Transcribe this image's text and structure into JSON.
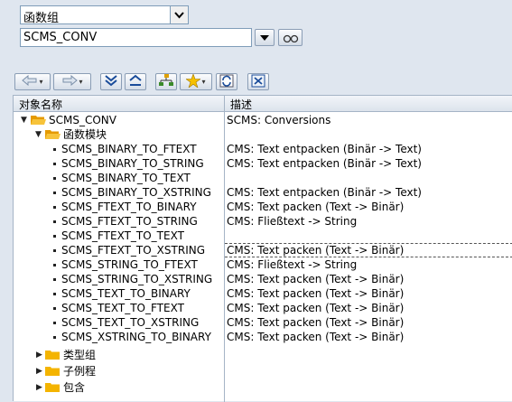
{
  "header": {
    "function_group_select": "函数组",
    "search_value": "SCMS_CONV"
  },
  "toolbar": {
    "buttons": [
      "back-arrow-icon",
      "forward-arrow-icon",
      "expand-all-icon",
      "collapse-all-icon",
      "hierarchy-icon",
      "favorite-star-icon",
      "refresh-icon",
      "close-icon"
    ]
  },
  "tree": {
    "columns": [
      "对象名称",
      "描述"
    ],
    "root": {
      "label": "SCMS_CONV",
      "desc": "SCMS: Conversions"
    },
    "module_folder": "函数模块",
    "functions": [
      {
        "name": "SCMS_BINARY_TO_FTEXT",
        "desc": "CMS: Text entpacken (Binär -> Text)"
      },
      {
        "name": "SCMS_BINARY_TO_STRING",
        "desc": "CMS: Text entpacken (Binär -> Text)"
      },
      {
        "name": "SCMS_BINARY_TO_TEXT",
        "desc": ""
      },
      {
        "name": "SCMS_BINARY_TO_XSTRING",
        "desc": "CMS: Text entpacken (Binär -> Text)"
      },
      {
        "name": "SCMS_FTEXT_TO_BINARY",
        "desc": "CMS: Text packen (Text -> Binär)"
      },
      {
        "name": "SCMS_FTEXT_TO_STRING",
        "desc": "CMS: Fließtext -> String"
      },
      {
        "name": "SCMS_FTEXT_TO_TEXT",
        "desc": ""
      },
      {
        "name": "SCMS_FTEXT_TO_XSTRING",
        "desc": "CMS: Text packen (Text -> Binär)"
      },
      {
        "name": "SCMS_STRING_TO_FTEXT",
        "desc": "CMS: Fließtext -> String"
      },
      {
        "name": "SCMS_STRING_TO_XSTRING",
        "desc": "CMS: Text packen (Text -> Binär)"
      },
      {
        "name": "SCMS_TEXT_TO_BINARY",
        "desc": "CMS: Text packen (Text -> Binär)"
      },
      {
        "name": "SCMS_TEXT_TO_FTEXT",
        "desc": "CMS: Text packen (Text -> Binär)"
      },
      {
        "name": "SCMS_TEXT_TO_XSTRING",
        "desc": "CMS: Text packen (Text -> Binär)"
      },
      {
        "name": "SCMS_XSTRING_TO_BINARY",
        "desc": "CMS: Text packen (Text -> Binär)"
      }
    ],
    "other_folders": [
      "类型组",
      "子例程",
      "包含"
    ],
    "selected_function": "SCMS_FTEXT_TO_XSTRING"
  },
  "colors": {
    "folder": "#f4b400",
    "selection_border": "#e03030",
    "header_bg": "#dce3ec"
  }
}
